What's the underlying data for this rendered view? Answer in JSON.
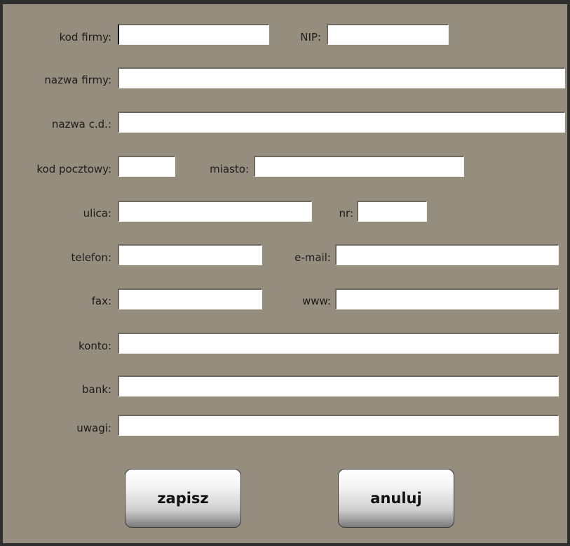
{
  "form": {
    "fields": {
      "kod_firmy": {
        "label": "kod firmy:",
        "value": ""
      },
      "nip": {
        "label": "NIP:",
        "value": ""
      },
      "nazwa_firmy": {
        "label": "nazwa firmy:",
        "value": ""
      },
      "nazwa_cd": {
        "label": "nazwa c.d.:",
        "value": ""
      },
      "kod_pocztowy": {
        "label": "kod pocztowy:",
        "value": ""
      },
      "miasto": {
        "label": "miasto:",
        "value": ""
      },
      "ulica": {
        "label": "ulica:",
        "value": ""
      },
      "nr": {
        "label": "nr:",
        "value": ""
      },
      "telefon": {
        "label": "telefon:",
        "value": ""
      },
      "email": {
        "label": "e-mail:",
        "value": ""
      },
      "fax": {
        "label": "fax:",
        "value": ""
      },
      "www": {
        "label": "www:",
        "value": ""
      },
      "konto": {
        "label": "konto:",
        "value": ""
      },
      "bank": {
        "label": "bank:",
        "value": ""
      },
      "uwagi": {
        "label": "uwagi:",
        "value": ""
      }
    },
    "buttons": {
      "save_label": "zapisz",
      "cancel_label": "anuluj"
    }
  },
  "colors": {
    "background": "#958d7e",
    "frame": "#2e2e2e",
    "field": "#ffffff"
  }
}
